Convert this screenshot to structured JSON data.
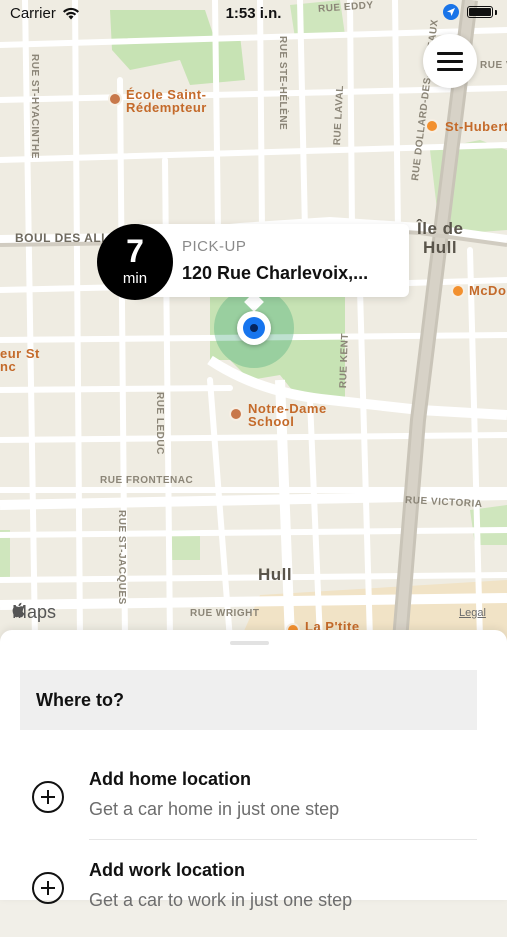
{
  "status_bar": {
    "carrier": "Carrier",
    "time": "1:53 i.n.",
    "icons": [
      "wifi-icon",
      "location-arrow-icon",
      "battery-icon"
    ]
  },
  "map": {
    "street_labels": [
      "RUE ST-HYACINTHE",
      "RUE STE-HÉLÈNE",
      "RUE LAVAL",
      "RUE DOLLARD-DES-ORMEAUX",
      "RUE EDDY",
      "RUE VERDUN",
      "BOUL DES ALL",
      "RUE LEDUC",
      "RUE KENT",
      "RUE FRONTENAC",
      "RUE ST-JACQUES",
      "RUE VICTORIA",
      "RUE WRIGHT"
    ],
    "district_labels": [
      "Île de",
      "Hull",
      "Hull"
    ],
    "pois": [
      {
        "name_line1": "École Saint-",
        "name_line2": "Rédempteur",
        "icon": "school-icon"
      },
      {
        "name_line1": "St-Hubert",
        "icon": "restaurant-icon"
      },
      {
        "name_line1": "McDo",
        "icon": "restaurant-icon"
      },
      {
        "name_line1": "eur St",
        "name_line2": "nc",
        "icon": "school-icon"
      },
      {
        "name_line1": "Notre-Dame",
        "name_line2": "School",
        "icon": "school-icon"
      },
      {
        "name_line1": "La P'tite",
        "icon": "restaurant-icon"
      }
    ],
    "attribution": "Maps",
    "legal": "Legal"
  },
  "pickup": {
    "eta_value": "7",
    "eta_unit": "min",
    "caption": "PICK-UP",
    "address": "120 Rue Charlevoix,..."
  },
  "sheet": {
    "where_to": "Where to?",
    "options": [
      {
        "title": "Add home location",
        "subtitle": "Get a car home in just one step",
        "icon": "plus-circle-icon"
      },
      {
        "title": "Add work location",
        "subtitle": "Get a car to work in just one step",
        "icon": "plus-circle-icon"
      }
    ]
  },
  "colors": {
    "map_base": "#f3f0e6",
    "park_green": "#c7e3b4",
    "poi_orange": "#f2902f",
    "user_blue": "#1775ee"
  }
}
